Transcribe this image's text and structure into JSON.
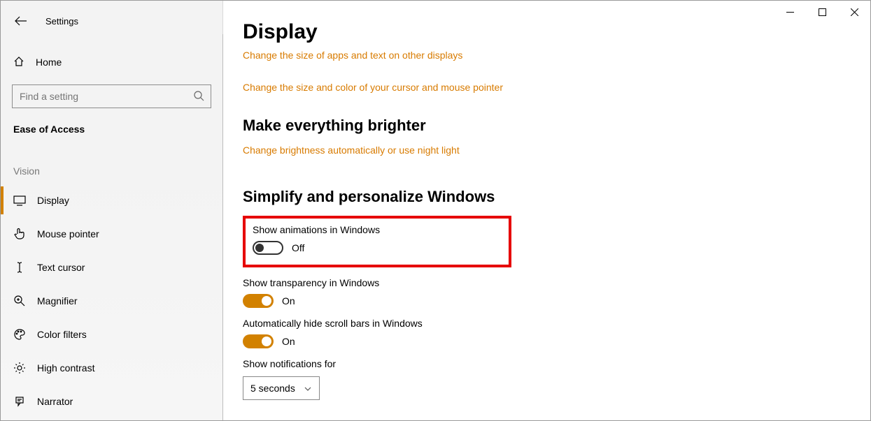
{
  "app": {
    "title": "Settings"
  },
  "sidebar": {
    "home": "Home",
    "search_placeholder": "Find a setting",
    "category": "Ease of Access",
    "section_label": "Vision",
    "items": [
      {
        "label": "Display"
      },
      {
        "label": "Mouse pointer"
      },
      {
        "label": "Text cursor"
      },
      {
        "label": "Magnifier"
      },
      {
        "label": "Color filters"
      },
      {
        "label": "High contrast"
      },
      {
        "label": "Narrator"
      }
    ]
  },
  "main": {
    "title": "Display",
    "links": {
      "size": "Change the size of apps and text on other displays",
      "cursor": "Change the size and color of your cursor and mouse pointer",
      "brightness": "Change brightness automatically or use night light"
    },
    "sections": {
      "brighter": "Make everything brighter",
      "simplify": "Simplify and personalize Windows"
    },
    "toggles": {
      "animations": {
        "label": "Show animations in Windows",
        "state": "Off"
      },
      "transparency": {
        "label": "Show transparency in Windows",
        "state": "On"
      },
      "scrollbars": {
        "label": "Automatically hide scroll bars in Windows",
        "state": "On"
      }
    },
    "notifications": {
      "label": "Show notifications for",
      "value": "5 seconds"
    }
  },
  "highlight": {
    "target": "animations"
  }
}
